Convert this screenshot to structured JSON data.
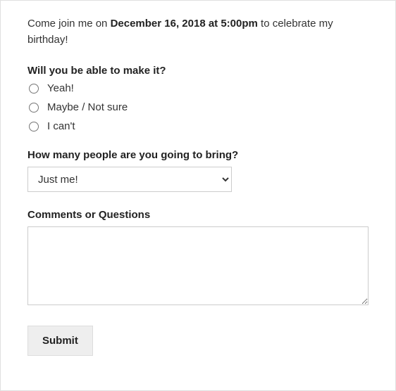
{
  "intro": {
    "prefix": "Come join me on ",
    "datetime": "December 16, 2018 at 5:00pm",
    "suffix": " to celebrate my birthday!"
  },
  "attendance": {
    "label": "Will you be able to make it?",
    "options": [
      {
        "value": "yeah",
        "label": "Yeah!"
      },
      {
        "value": "maybe",
        "label": "Maybe / Not sure"
      },
      {
        "value": "cant",
        "label": "I can't"
      }
    ]
  },
  "guests": {
    "label": "How many people are you going to bring?",
    "selected": "Just me!"
  },
  "comments": {
    "label": "Comments or Questions",
    "value": ""
  },
  "submit": {
    "label": "Submit"
  }
}
